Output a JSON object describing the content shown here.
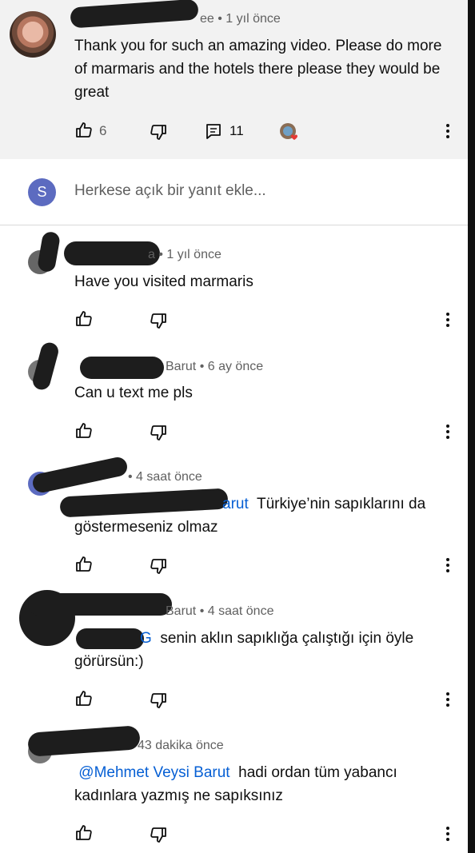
{
  "top_comment": {
    "author_partial": "ee",
    "time": "• 1 yıl önce",
    "text": "Thank you for such an amazing video. Please do more of marmaris and the hotels there please they would be great",
    "likes": "6",
    "replies": "11"
  },
  "reply_box": {
    "avatar_letter": "S",
    "placeholder": "Herkese açık bir yanıt ekle..."
  },
  "replies": [
    {
      "meta": "a • 1 yıl önce",
      "text": "Have you visited marmaris"
    },
    {
      "meta": "Barut • 6 ay önce",
      "text": "Can u text me pls"
    },
    {
      "meta": "• 4 saat önce",
      "mention": "arut",
      "text": "Türkiye’nin sapıklarını da göstermeseniz olmaz"
    },
    {
      "meta": "Barut • 4 saat önce",
      "mention": "G",
      "text": "senin aklın sapıklığa çalıştığı için öyle görürsün:)"
    },
    {
      "meta": "43 dakika önce",
      "mention": "@Mehmet Veysi Barut",
      "text": "hadi ordan tüm yabancı kadınlara yazmış ne sapıksınız"
    }
  ],
  "colors": {
    "mention": "#065fd4",
    "meta": "#606060",
    "highlight_bg": "#f2f2f2",
    "avatar_s": "#5c6bc0"
  }
}
